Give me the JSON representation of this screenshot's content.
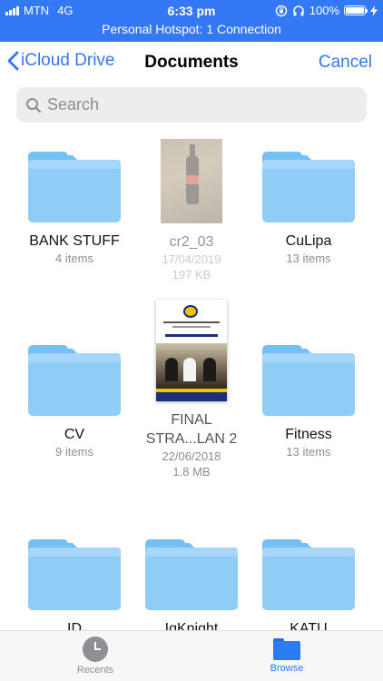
{
  "status_bar": {
    "carrier": "MTN",
    "network": "4G",
    "time": "6:33 pm",
    "battery": "100%",
    "hotspot": "Personal Hotspot: 1 Connection",
    "color": "#3478f6"
  },
  "nav": {
    "back_label": "iCloud Drive",
    "title": "Documents",
    "cancel_label": "Cancel"
  },
  "search": {
    "placeholder": "Search"
  },
  "items": [
    {
      "name": "BANK STUFF",
      "meta": "4 items",
      "kind": "folder"
    },
    {
      "name": "cr2_03",
      "date": "17/04/2019",
      "size": "197 KB",
      "kind": "photo"
    },
    {
      "name": "CuLipa",
      "meta": "13 items",
      "kind": "folder"
    },
    {
      "name": "CV",
      "meta": "9 items",
      "kind": "folder"
    },
    {
      "name": "FINAL STRA...LAN 2",
      "date": "22/06/2018",
      "size": "1.8 MB",
      "kind": "document"
    },
    {
      "name": "Fitness",
      "meta": "13 items",
      "kind": "folder"
    },
    {
      "name": "ID",
      "kind": "folder"
    },
    {
      "name": "IqKnight",
      "kind": "folder"
    },
    {
      "name": "KATU",
      "kind": "folder"
    }
  ],
  "tab_bar": {
    "recents": "Recents",
    "browse": "Browse",
    "active_color": "#2b7cf0",
    "inactive_color": "#8e8e93"
  }
}
